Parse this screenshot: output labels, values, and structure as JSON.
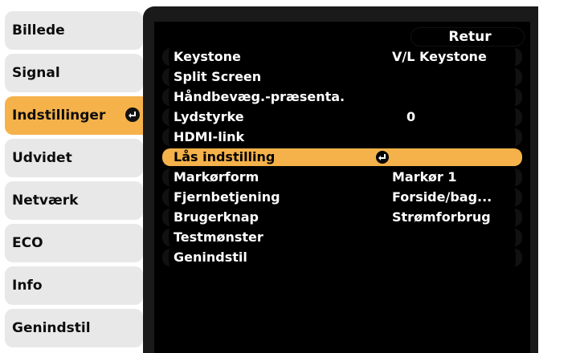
{
  "tabs": [
    {
      "label": "Billede"
    },
    {
      "label": "Signal"
    },
    {
      "label": "Indstillinger",
      "active": true
    },
    {
      "label": "Udvidet"
    },
    {
      "label": "Netværk"
    },
    {
      "label": "ECO"
    },
    {
      "label": "Info"
    },
    {
      "label": "Genindstil"
    }
  ],
  "header": {
    "return_label": "Retur"
  },
  "menu": {
    "items": [
      {
        "label": "Keystone",
        "value": "V/L Keystone"
      },
      {
        "label": "Split Screen",
        "value": ""
      },
      {
        "label": "Håndbevæg.-præsenta.",
        "value": ""
      },
      {
        "label": "Lydstyrke",
        "value": "0"
      },
      {
        "label": "HDMI-link",
        "value": ""
      },
      {
        "label": "Lås indstilling",
        "value": "",
        "selected": true
      },
      {
        "label": "Markørform",
        "value": "Markør 1"
      },
      {
        "label": "Fjernbetjening",
        "value": "Forside/bag..."
      },
      {
        "label": "Brugerknap",
        "value": "Strømforbrug"
      },
      {
        "label": "Testmønster",
        "value": ""
      },
      {
        "label": "Genindstil",
        "value": ""
      }
    ]
  },
  "icons": {
    "enter": "enter-arrow-icon"
  },
  "colors": {
    "accent": "#f5b24a",
    "panel": "#000000",
    "tab": "#e8e8e8"
  }
}
